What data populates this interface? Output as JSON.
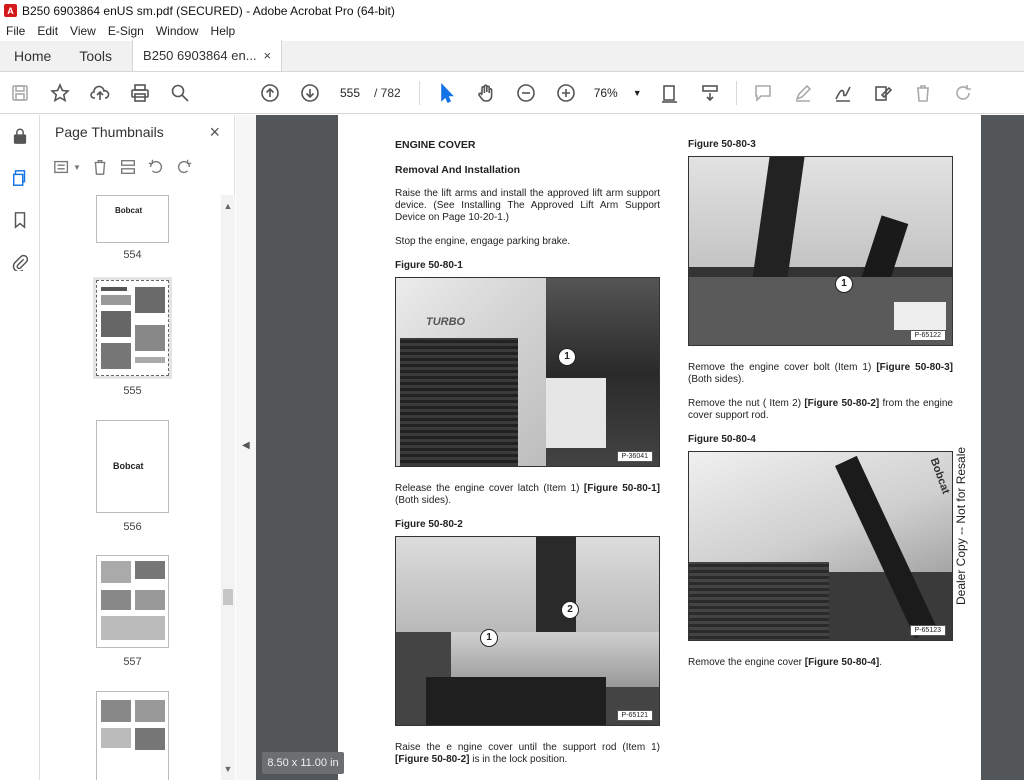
{
  "window": {
    "title": "B250 6903864 enUS sm.pdf (SECURED) - Adobe Acrobat Pro (64-bit)",
    "app_icon_text": "A"
  },
  "menu": [
    "File",
    "Edit",
    "View",
    "E-Sign",
    "Window",
    "Help"
  ],
  "tabs": {
    "home": "Home",
    "tools": "Tools",
    "document": "B250 6903864 en...",
    "close": "×"
  },
  "toolbar": {
    "current_page": "555",
    "total_pages": "/ 782",
    "zoom": "76%"
  },
  "thumbnails": {
    "title": "Page Thumbnails",
    "close": "×",
    "pages": [
      {
        "label": "554",
        "text": "Bobcat"
      },
      {
        "label": "555",
        "selected": true
      },
      {
        "label": "556",
        "text": "Bobcat"
      },
      {
        "label": "557"
      },
      {
        "label": ""
      }
    ]
  },
  "page_size": "8.50 x 11.00 in",
  "document": {
    "left": {
      "section_title": "ENGINE COVER",
      "subtitle": "Removal And Installation",
      "para1": "Raise the lift arms and install the approved lift arm support device. (See Installing The Approved Lift Arm Support Device on Page 10-20-1.)",
      "para2": "Stop the engine, engage parking brake.",
      "fig1_label": "Figure 50-80-1",
      "fig1_tag": "P-36041",
      "fig1_brand": "TURBO",
      "fig1_callout": "1",
      "para3_pre": "Release the engine cover latch (Item 1) ",
      "para3_bold": "[Figure 50-80-1]",
      "para3_post": " (Both sides).",
      "fig2_label": "Figure 50-80-2",
      "fig2_tag": "P-65121",
      "fig2_callout1": "1",
      "fig2_callout2": "2",
      "para4_pre": "Raise the e ngine cover until the support rod (Item 1) ",
      "para4_bold": "[Figure 50-80-2]",
      "para4_post": " is in the lock position."
    },
    "right": {
      "fig3_label": "Figure 50-80-3",
      "fig3_tag": "P-65122",
      "fig3_callout": "1",
      "para1_pre": "Remove the engine cover bolt (Item 1) ",
      "para1_bold": "[Figure 50-80-3]",
      "para1_post": " (Both sides).",
      "para2_pre": "Remove the nut ( Item 2) ",
      "para2_bold": "[Figure 50-80-2]",
      "para2_post": " from the engine cover support rod.",
      "fig4_label": "Figure 50-80-4",
      "fig4_tag": "P-65123",
      "fig4_brand": "Bobcat",
      "para3_pre": "Remove the engine cover ",
      "para3_bold": "[Figure 50-80-4]",
      "para3_post": "."
    },
    "watermark": "Dealer Copy -- Not for Resale"
  }
}
